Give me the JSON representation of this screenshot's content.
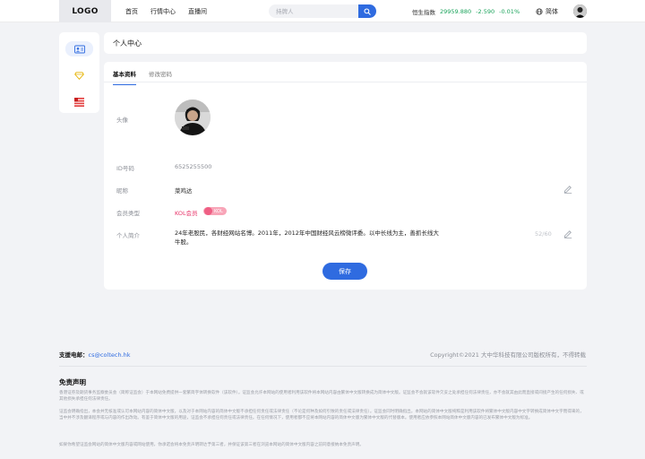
{
  "header": {
    "logo": "LOGO",
    "nav": [
      "首页",
      "行情中心",
      "直播间"
    ],
    "search_placeholder": "持牌人",
    "index": {
      "name": "恒生指数",
      "value": "29959.880",
      "change": "-2.590",
      "pct": "-0.01%"
    },
    "language": "简体"
  },
  "sidebar": {
    "icons": [
      "profile-card-icon",
      "diamond-icon",
      "flag-list-icon"
    ]
  },
  "page_title": "个人中心",
  "tabs": [
    "基本资料",
    "修改密码"
  ],
  "profile": {
    "avatar_label": "头像",
    "id_label": "ID号码",
    "id_value": "6525255500",
    "nickname_label": "昵称",
    "nickname": "菜鸡达",
    "member_label": "会员类型",
    "member_type": "KOL会员",
    "member_badge": "KOL",
    "intro_label": "个人简介",
    "intro": "24年老股民，各财经网站名博。2011年，2012年中国财经风云榜微评委。以中长线为主，善抓长线大牛股。",
    "intro_count": "52/60"
  },
  "save_label": "保存",
  "footer": {
    "contact_label": "支援电邮：",
    "contact_email": "cs@coltech.hk",
    "copyright": "Copyright©2021 大中华科技有限公司版权所有，不得转载",
    "disclaimer_title": "免责声明",
    "para1": "香港证券及期货事务监察委员会（简称证监会）于本网站免费提供一套繁简字体转换软件（该软件）。证监会允许本网站的使用者利用该软件将本网站内容由繁体中文版转换成为简体中文版。证监会不会就该软件欠妥之处承担任何法律责任，亦不会就其由此而直接或间接产生的任何损失、或其他损失承担任何法律责任。",
    "para2": "证监会明确指出，本会并无核准或认可本网站内容的简体中文版，以及对于本网站内容的简体中文版不承担任何责任或法律责任（不论是何种及如何引致的责任或法律责任）。证监会同时明确指出，本网站的简体中文版纯粹是利用该软件将繁体中文版内容中文字转换成简体中文字而得来的，当中并不涉及翻译程序或与内容的作出改动。有鉴于简体中文版的用途，证监会不承担任何责任或法律责任。在任何情况下，使用者都不应将本网站内容的简体中文版为繁体中文版的代替版本。使用者应依参照本网站简体中文版内容的已发布繁体中文版为标准。",
    "para3": "如果你希望证监会网站的简体中文版内容或网站使用，你承诺会将本免责声明转达予第三者，并保证该第三者在浏览本网站的简体中文版内容之前同意接纳本免责声明。"
  }
}
